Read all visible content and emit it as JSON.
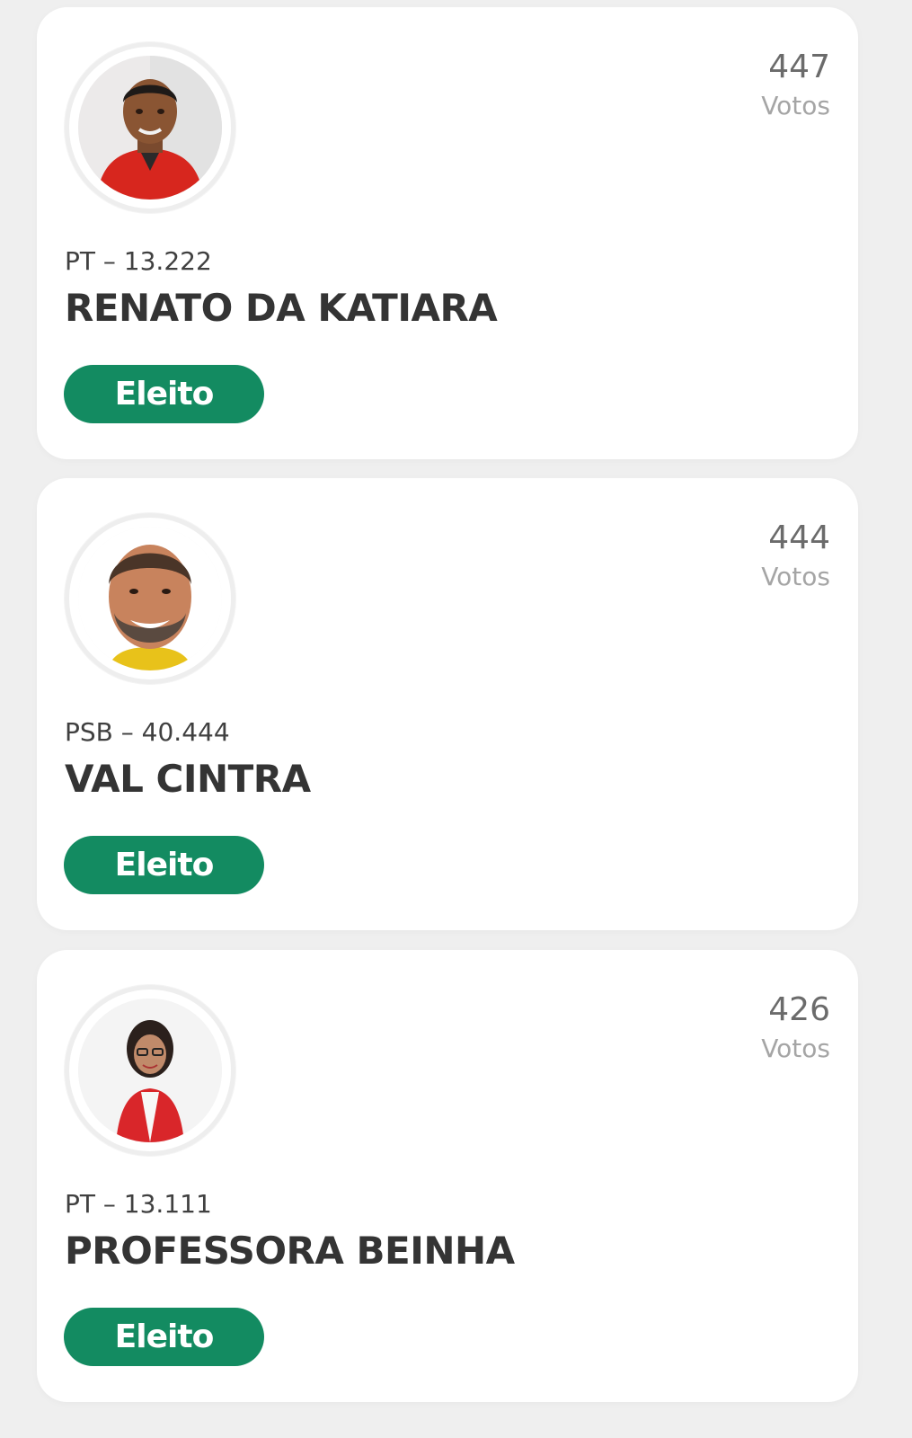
{
  "candidates": [
    {
      "votes": "447",
      "votes_label": "Votos",
      "party": "PT – 13.222",
      "name": "RENATO DA KATIARA",
      "status": "Eleito",
      "photo": "candidate-photo"
    },
    {
      "votes": "444",
      "votes_label": "Votos",
      "party": "PSB – 40.444",
      "name": "VAL CINTRA",
      "status": "Eleito",
      "photo": "candidate-photo"
    },
    {
      "votes": "426",
      "votes_label": "Votos",
      "party": "PT – 13.111",
      "name": "PROFESSORA BEINHA",
      "status": "Eleito",
      "photo": "candidate-photo"
    }
  ],
  "colors": {
    "status_badge": "#138b61",
    "card_background": "#ffffff",
    "page_background": "#efefef"
  }
}
